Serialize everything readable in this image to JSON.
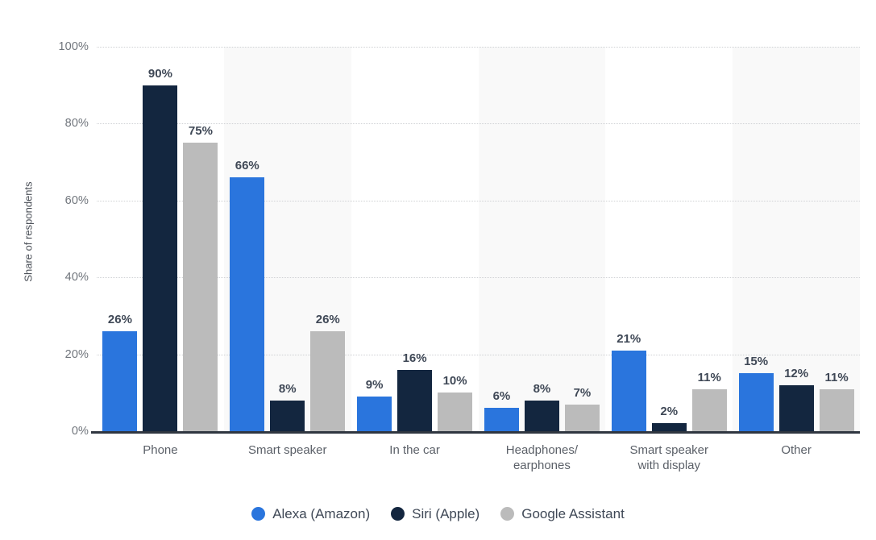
{
  "chart_data": {
    "type": "bar",
    "title": "",
    "subtitle": "",
    "xlabel": "",
    "ylabel": "Share of respondents",
    "ylim": [
      0,
      100
    ],
    "yticks": [
      "0%",
      "20%",
      "40%",
      "60%",
      "80%",
      "100%"
    ],
    "ytick_values": [
      0,
      20,
      40,
      60,
      80,
      100
    ],
    "grid": true,
    "legend_position": "bottom",
    "value_suffix": "%",
    "categories": [
      "Phone",
      "Smart speaker",
      "In the car",
      "Headphones/\nearphones",
      "Smart speaker\nwith display",
      "Other"
    ],
    "category_lines": [
      [
        "Phone"
      ],
      [
        "Smart speaker"
      ],
      [
        "In the car"
      ],
      [
        "Headphones/",
        "earphones"
      ],
      [
        "Smart speaker",
        "with display"
      ],
      [
        "Other"
      ]
    ],
    "series": [
      {
        "name": "Alexa (Amazon)",
        "color": "#2a75dd",
        "values": [
          26,
          66,
          9,
          6,
          21,
          15
        ],
        "labels": [
          "26%",
          "66%",
          "9%",
          "6%",
          "21%",
          "15%"
        ]
      },
      {
        "name": "Siri (Apple)",
        "color": "#13263f",
        "values": [
          90,
          8,
          16,
          8,
          2,
          12
        ],
        "labels": [
          "90%",
          "8%",
          "16%",
          "8%",
          "2%",
          "12%"
        ]
      },
      {
        "name": "Google Assistant",
        "color": "#bbbbbb",
        "values": [
          75,
          26,
          10,
          7,
          11,
          11
        ],
        "labels": [
          "75%",
          "26%",
          "10%",
          "7%",
          "11%",
          "11%"
        ]
      }
    ]
  },
  "legend": [
    {
      "label": "Alexa (Amazon)",
      "color": "#2a75dd",
      "marker": "circle-marker"
    },
    {
      "label": "Siri (Apple)",
      "color": "#13263f",
      "marker": "circle-marker"
    },
    {
      "label": "Google Assistant",
      "color": "#bbbbbb",
      "marker": "circle-marker"
    }
  ]
}
